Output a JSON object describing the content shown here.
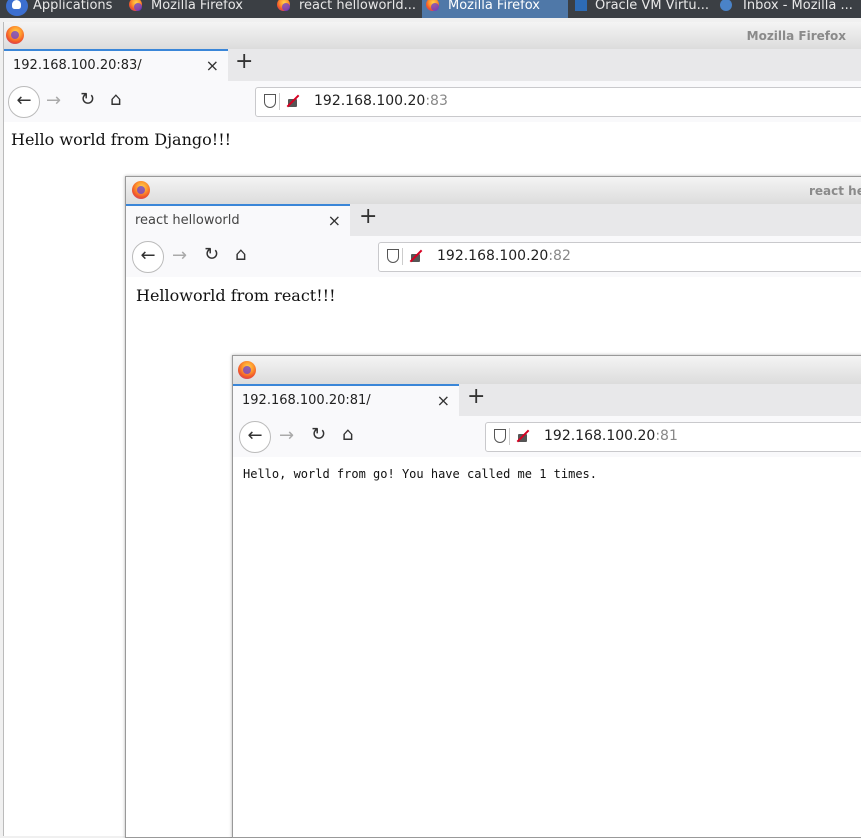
{
  "taskbar": {
    "applications": "Applications",
    "tasks": [
      {
        "label": "Mozilla Firefox",
        "icon": "firefox-icon",
        "active": false
      },
      {
        "label": "react helloworld...",
        "icon": "firefox-icon",
        "active": false
      },
      {
        "label": "Mozilla Firefox",
        "icon": "firefox-icon",
        "active": true
      },
      {
        "label": "Oracle VM Virtu...",
        "icon": "virtualbox-icon",
        "active": false
      },
      {
        "label": "Inbox - Mozilla ...",
        "icon": "thunderbird-icon",
        "active": false
      }
    ]
  },
  "windows": [
    {
      "title": "Mozilla Firefox",
      "tab_label": "192.168.100.20:83/",
      "url_host": "192.168.100.20",
      "url_port": ":83",
      "content": "Hello world from Django!!!"
    },
    {
      "title": "react he",
      "tab_label": "react helloworld",
      "url_host": "192.168.100.20",
      "url_port": ":82",
      "content": "Helloworld from react!!!"
    },
    {
      "title": "",
      "tab_label": "192.168.100.20:81/",
      "url_host": "192.168.100.20",
      "url_port": ":81",
      "content": "Hello, world from go! You have called me 1 times."
    }
  ],
  "colors": {
    "accent_tab": "#3a86d8",
    "taskbar_bg": "#3b3f44",
    "active_task": "#4f78a8"
  },
  "icons": {
    "close": "×",
    "new_tab": "+",
    "back": "←",
    "forward": "→",
    "reload": "↻",
    "home": "⌂"
  }
}
